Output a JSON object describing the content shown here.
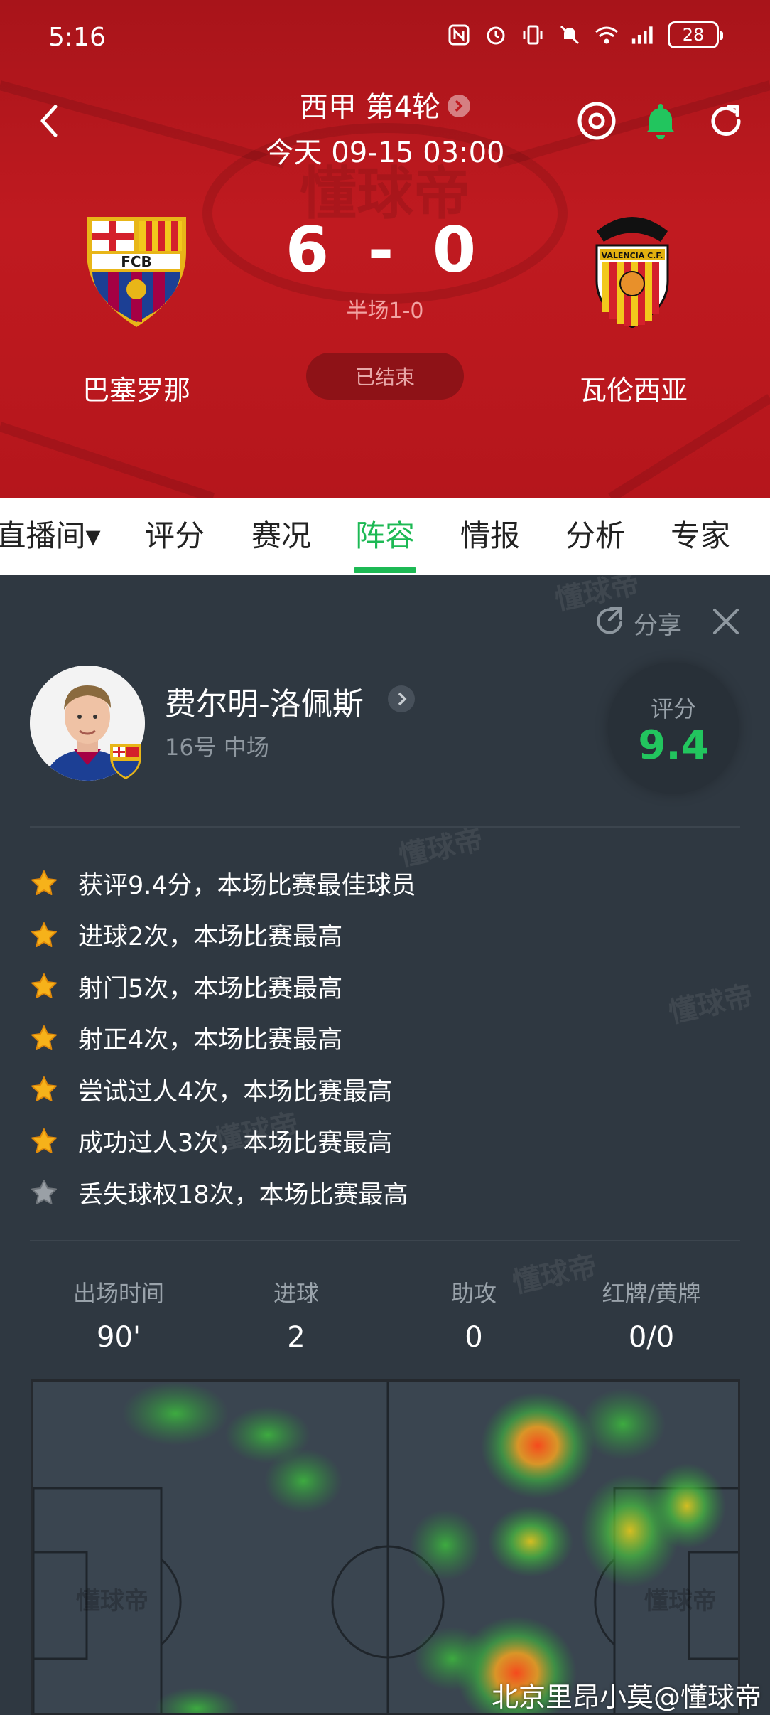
{
  "status_bar": {
    "time": "5:16",
    "battery": "28",
    "icons": [
      "nfc-icon",
      "alarm-icon",
      "vibrate-icon",
      "mute-icon",
      "wifi-icon",
      "signal-icon"
    ]
  },
  "header": {
    "league": "西甲 第4轮",
    "datetime": "今天 09-15 03:00",
    "watermark": "懂球帝",
    "home": {
      "name": "巴塞罗那",
      "logo_text": "FCB"
    },
    "away": {
      "name": "瓦伦西亚",
      "logo_text": "VALENCIA C.F."
    },
    "score": "6 - 0",
    "halftime": "半场1-0",
    "status": "已结束"
  },
  "tabs": [
    {
      "label": "直播间▾"
    },
    {
      "label": "评分"
    },
    {
      "label": "赛况"
    },
    {
      "label": "阵容",
      "active": true
    },
    {
      "label": "情报"
    },
    {
      "label": "分析"
    },
    {
      "label": "专家"
    }
  ],
  "player_card": {
    "share_label": "分享",
    "name": "费尔明-洛佩斯",
    "meta": "16号 中场",
    "rating_label": "评分",
    "rating": "9.4",
    "highlights": [
      {
        "text": "获评9.4分，本场比赛最佳球员",
        "star": "gold"
      },
      {
        "text": "进球2次，本场比赛最高",
        "star": "gold"
      },
      {
        "text": "射门5次，本场比赛最高",
        "star": "gold"
      },
      {
        "text": "射正4次，本场比赛最高",
        "star": "gold"
      },
      {
        "text": "尝试过人4次，本场比赛最高",
        "star": "gold"
      },
      {
        "text": "成功过人3次，本场比赛最高",
        "star": "gold"
      },
      {
        "text": "丢失球权18次，本场比赛最高",
        "star": "gray"
      }
    ],
    "stats": [
      {
        "label": "出场时间",
        "value": "90'"
      },
      {
        "label": "进球",
        "value": "2"
      },
      {
        "label": "助攻",
        "value": "0"
      },
      {
        "label": "红牌/黄牌",
        "value": "0/0"
      }
    ],
    "watermark": "懂球帝"
  },
  "credit": "北京里昂小莫@懂球帝",
  "colors": {
    "header_red": "#c01a20",
    "accent_green": "#1db954",
    "card_bg": "#2f3841"
  }
}
